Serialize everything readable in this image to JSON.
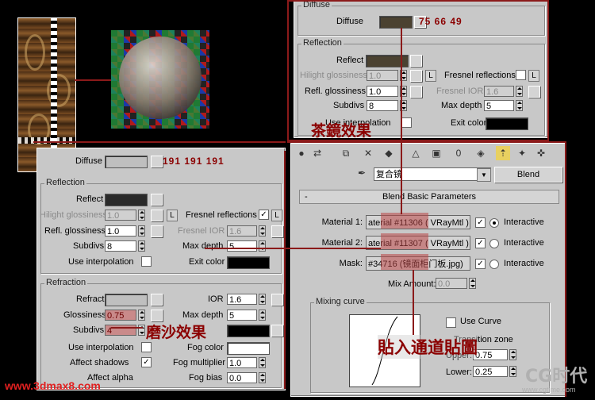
{
  "top_panel": {
    "diffuse_group": "Diffuse",
    "diffuse_label": "Diffuse",
    "diffuse_rgb": "75  66  49",
    "reflection_group": "Reflection",
    "reflect_label": "Reflect",
    "hilight_label": "Hilight glossiness",
    "hilight_value": "1.0",
    "refl_gloss_label": "Refl. glossiness",
    "refl_gloss_value": "1.0",
    "subdivs_label": "Subdivs",
    "subdivs_value": "8",
    "use_interp_label": "Use interpolation",
    "fresnel_label": "Fresnel reflections",
    "fresnel_ior_label": "Fresnel IOR",
    "fresnel_ior_value": "1.6",
    "max_depth_label": "Max depth",
    "max_depth_value": "5",
    "exit_color_label": "Exit color",
    "l_btn": "L",
    "annotation": "茶鏡效果"
  },
  "left_panel": {
    "diffuse_label": "Diffuse",
    "diffuse_rgb": "191  191  191",
    "reflection_group": "Reflection",
    "reflect_label": "Reflect",
    "hilight_label": "Hilight glossiness",
    "hilight_value": "1.0",
    "refl_gloss_label": "Refl. glossiness",
    "refl_gloss_value": "1.0",
    "subdivs_label": "Subdivs",
    "subdivs_value": "8",
    "use_interp_label": "Use interpolation",
    "fresnel_label": "Fresnel reflections",
    "fresnel_check": "✓",
    "fresnel_ior_label": "Fresnel IOR",
    "fresnel_ior_value": "1.6",
    "max_depth_label": "Max depth",
    "max_depth_value": "5",
    "exit_color_label": "Exit color",
    "l_btn": "L",
    "refraction_group": "Refraction",
    "refract_label": "Refract",
    "glossiness_label": "Glossiness",
    "glossiness_value": "0.75",
    "r_subdivs_label": "Subdivs",
    "r_subdivs_value": "4",
    "r_use_interp_label": "Use interpolation",
    "affect_shadows_label": "Affect shadows",
    "affect_shadows_check": "✓",
    "affect_alpha_label": "Affect alpha",
    "ior_label": "IOR",
    "ior_value": "1.6",
    "r_max_depth_label": "Max depth",
    "r_max_depth_value": "5",
    "fog_color_label": "Fog color",
    "fog_mult_label": "Fog multiplier",
    "fog_mult_value": "1.0",
    "fog_bias_label": "Fog bias",
    "fog_bias_value": "0.0",
    "annotation": "磨沙效果"
  },
  "right_panel": {
    "material_name": "复合镜",
    "blend_button": "Blend",
    "rollout_toggle": "-",
    "rollout_title": "Blend Basic Parameters",
    "material1_label": "Material 1:",
    "material1_value": "aterial #11306  ( VRayMtl )",
    "material2_label": "Material 2:",
    "material2_value": "aterial #11307  ( VRayMtl )",
    "mask_label": "Mask:",
    "mask_value": "#34716 (镜面柜门板.jpg)",
    "check": "✓",
    "interactive_label": "Interactive",
    "mix_amount_label": "Mix Amount:",
    "mix_amount_value": "0.0",
    "mixing_curve_group": "Mixing curve",
    "use_curve_label": "Use Curve",
    "transition_label": "Transition zone",
    "upper_label": "Upper:",
    "upper_value": "0.75",
    "lower_label": "Lower:",
    "lower_value": "0.25",
    "annotation": "貼入通道貼圖"
  },
  "watermarks": {
    "site": "www.3dmax8.com",
    "brand": "CG时代",
    "brand_url": "www.cgtime.com"
  }
}
